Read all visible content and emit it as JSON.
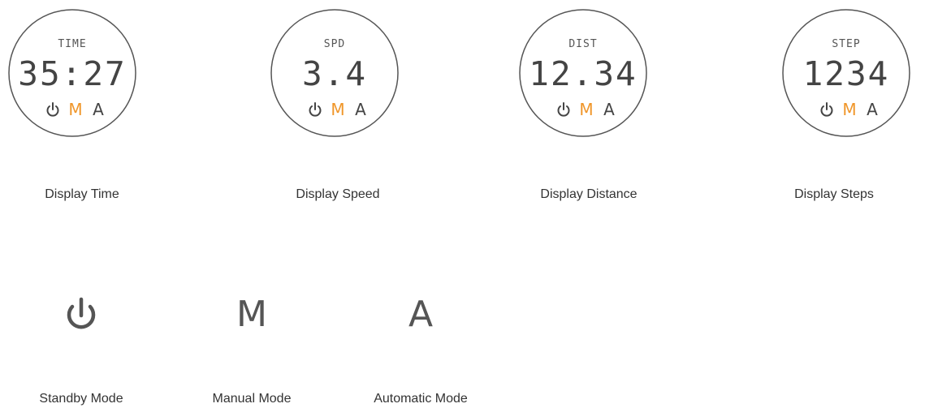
{
  "displays": [
    {
      "label": "TIME",
      "value": "35:27",
      "caption": "Display Time"
    },
    {
      "label": "SPD",
      "value": "3.4",
      "caption": "Display Speed"
    },
    {
      "label": "DIST",
      "value": "12.34",
      "caption": "Display Distance"
    },
    {
      "label": "STEP",
      "value": "1234",
      "caption": "Display Steps"
    }
  ],
  "icons": {
    "power": "power-icon",
    "manual": "M",
    "auto": "A"
  },
  "modes": [
    {
      "icon": "power-icon",
      "caption": "Standby Mode"
    },
    {
      "icon": "M",
      "caption": "Manual Mode"
    },
    {
      "icon": "A",
      "caption": "Automatic Mode"
    }
  ],
  "colors": {
    "accent": "#f0962a",
    "ring": "#555555",
    "text": "#333333"
  }
}
